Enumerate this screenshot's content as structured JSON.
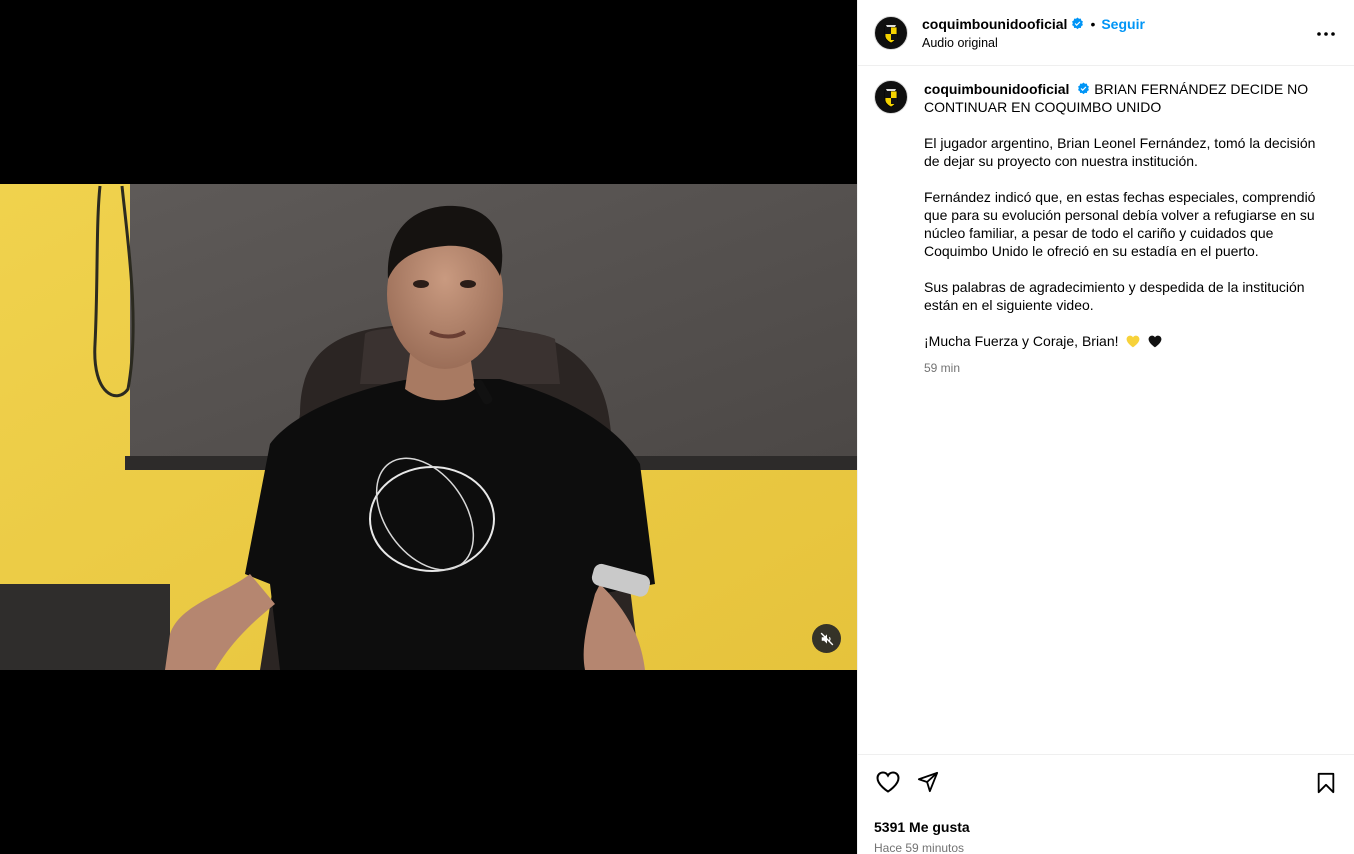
{
  "post": {
    "username": "coquimbounidooficial",
    "follow_label": "Seguir",
    "separator": "•",
    "audio_label": "Audio original",
    "caption": {
      "headline": "BRIAN FERNÁNDEZ DECIDE NO CONTINUAR EN COQUIMBO UNIDO",
      "paragraph_1": "El jugador argentino, Brian Leonel Fernández, tomó la decisión de dejar su proyecto con nuestra institución.",
      "paragraph_2": "Fernández indicó que, en estas fechas especiales, comprendió que para su evolución personal debía volver a refugiarse en su núcleo familiar, a pesar de todo el cariño y cuidados que Coquimbo Unido le ofreció en su estadía en el puerto.",
      "paragraph_3": "Sus palabras de agradecimiento y despedida de la institución están en el siguiente video.",
      "closing": "¡Mucha Fuerza y Coraje, Brian!",
      "time": "59 min"
    },
    "likes": "5391 Me gusta",
    "posted_ago": "Hace 59 minutos"
  },
  "icons": {
    "verified": "verified-badge-icon",
    "more": "more-options-icon",
    "like": "heart-icon",
    "share": "share-icon",
    "save": "bookmark-icon",
    "mute": "muted-speaker-icon"
  },
  "colors": {
    "link_blue": "#0095f6",
    "secondary_text": "#737373",
    "club_yellow": "#f5d300"
  }
}
